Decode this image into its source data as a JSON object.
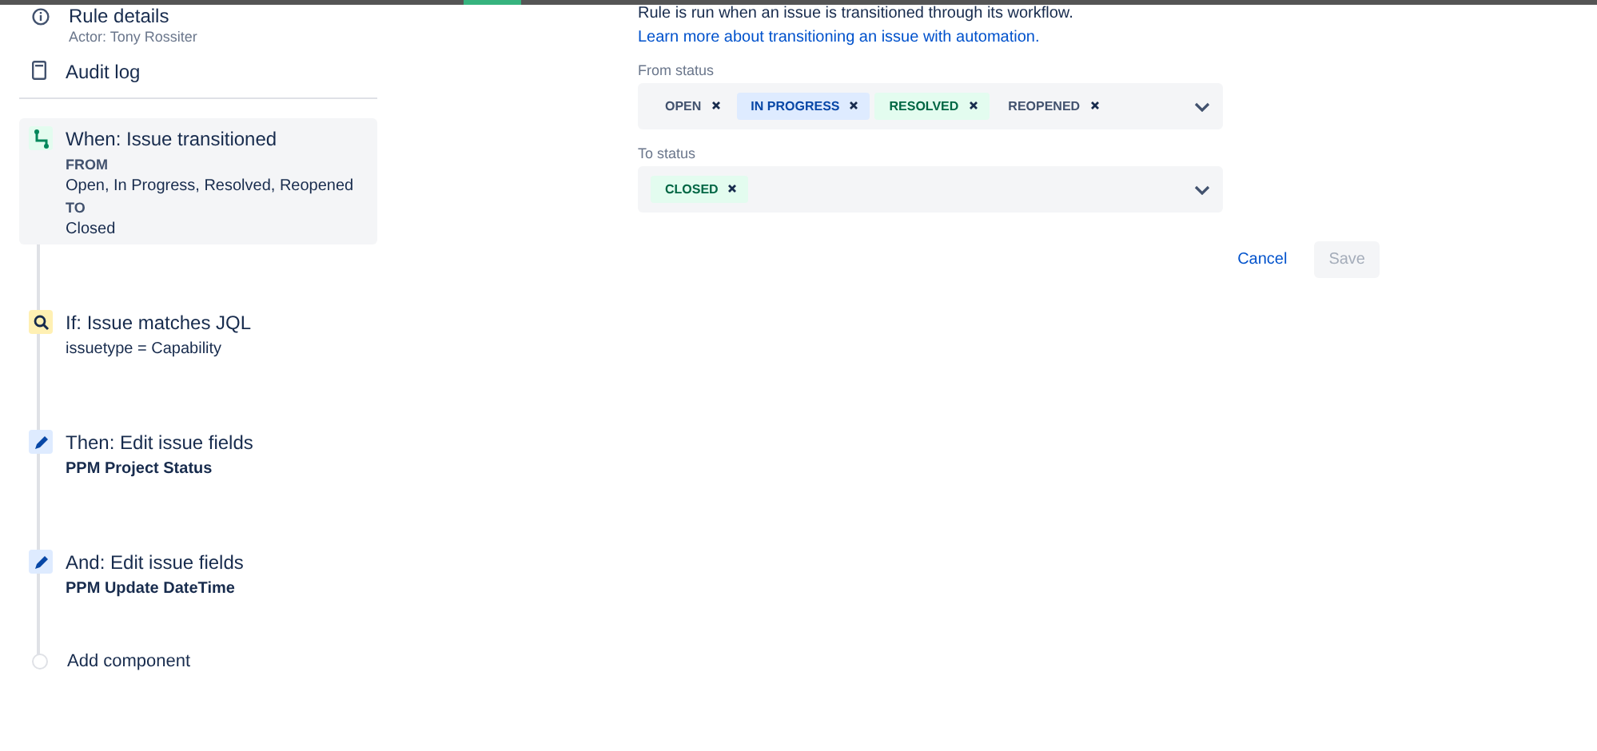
{
  "sidebar": {
    "details": {
      "title": "Rule details",
      "subtitle": "Actor: Tony Rossiter"
    },
    "audit": {
      "title": "Audit log"
    },
    "steps": [
      {
        "kind": "trigger",
        "selected": true,
        "title": "When: Issue transitioned",
        "lines": [
          {
            "kind": "heading",
            "text": "FROM"
          },
          {
            "kind": "plain",
            "text": "Open, In Progress, Resolved, Reopened"
          },
          {
            "kind": "heading",
            "text": "TO"
          },
          {
            "kind": "plain",
            "text": "Closed"
          }
        ]
      },
      {
        "kind": "condition",
        "selected": false,
        "title": "If: Issue matches JQL",
        "lines": [
          {
            "kind": "plain",
            "text": "issuetype = Capability"
          }
        ]
      },
      {
        "kind": "action",
        "selected": false,
        "title": "Then: Edit issue fields",
        "lines": [
          {
            "kind": "bold",
            "text": "PPM Project Status"
          }
        ]
      },
      {
        "kind": "action",
        "selected": false,
        "title": "And: Edit issue fields",
        "lines": [
          {
            "kind": "bold",
            "text": "PPM Update DateTime"
          }
        ]
      }
    ],
    "add": {
      "label": "Add component"
    }
  },
  "form": {
    "description": "Rule is run when an issue is transitioned through its workflow.",
    "link": "Learn more about transitioning an issue with automation.",
    "fields": [
      {
        "label": "From status",
        "tags": [
          {
            "text": "OPEN",
            "kind": "todo"
          },
          {
            "text": "IN PROGRESS",
            "kind": "inprogress"
          },
          {
            "text": "RESOLVED",
            "kind": "done"
          },
          {
            "text": "REOPENED",
            "kind": "todo"
          }
        ]
      },
      {
        "label": "To status",
        "tags": [
          {
            "text": "CLOSED",
            "kind": "done"
          }
        ]
      }
    ],
    "buttons": [
      {
        "label": "Cancel",
        "kind": "link",
        "disabled": false
      },
      {
        "label": "Save",
        "kind": "primary",
        "disabled": true
      }
    ]
  }
}
